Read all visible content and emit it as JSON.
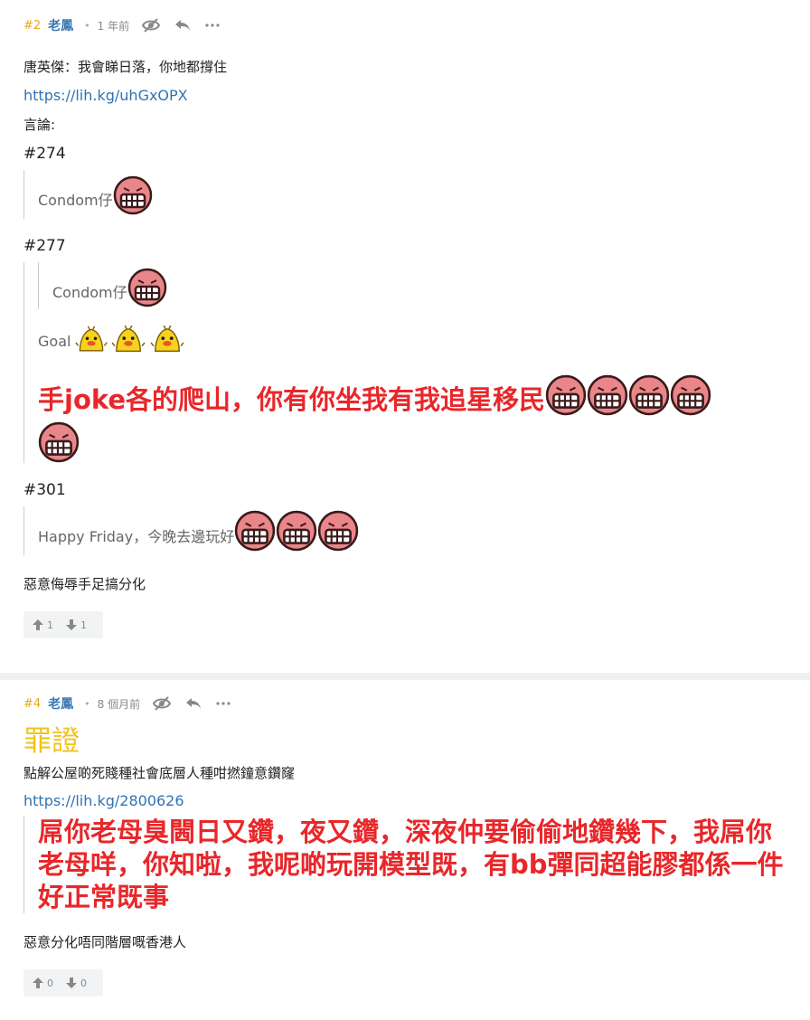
{
  "posts": [
    {
      "number": "#2",
      "username": "老鳳",
      "time": "1 年前",
      "headline": "唐英傑：我會睇日落，你地都撐住",
      "link": "https://lih.kg/uhGxOPX",
      "speech_label": "言論:",
      "refs": [
        "#274",
        "#277",
        "#301"
      ],
      "quote_274": "Condom仔",
      "quote_277_inner": "Condom仔",
      "quote_277_goal": "Goal",
      "quote_277_big": "手joke各的爬山，你有你坐我有我追星移民",
      "quote_301": "Happy Friday，今晚去邊玩好",
      "comment": "惡意侮辱手足搞分化",
      "upvotes": "1",
      "downvotes": "1"
    },
    {
      "number": "#4",
      "username": "老鳳",
      "time": "8 個月前",
      "title": "罪證",
      "headline": "點解公屋啲死賤種社會底層人種咁撚鐘意鑽窿",
      "link": "https://lih.kg/2800626",
      "quote_big": "屌你老母臭閪日又鑽，夜又鑽，深夜仲要偷偷地鑽幾下，我屌你老母咩，你知啦，我呢啲玩開模型既，有bb彈同超能膠都係一件好正常既事",
      "comment": "惡意分化唔同階層嘅香港人",
      "upvotes": "0",
      "downvotes": "0"
    }
  ],
  "icons": {
    "hide": "eye-off-icon",
    "reply": "reply-icon",
    "more": "more-icon",
    "upvote": "arrow-up-icon",
    "downvote": "arrow-down-icon",
    "grin_emoji": "grin-emoji",
    "duck_emoji": "duck-emoji"
  },
  "colors": {
    "number": "#e6a817",
    "username": "#3b78b5",
    "link": "#2f73b5",
    "red_text": "#e8272a",
    "yellow_title": "#f0c41d"
  }
}
